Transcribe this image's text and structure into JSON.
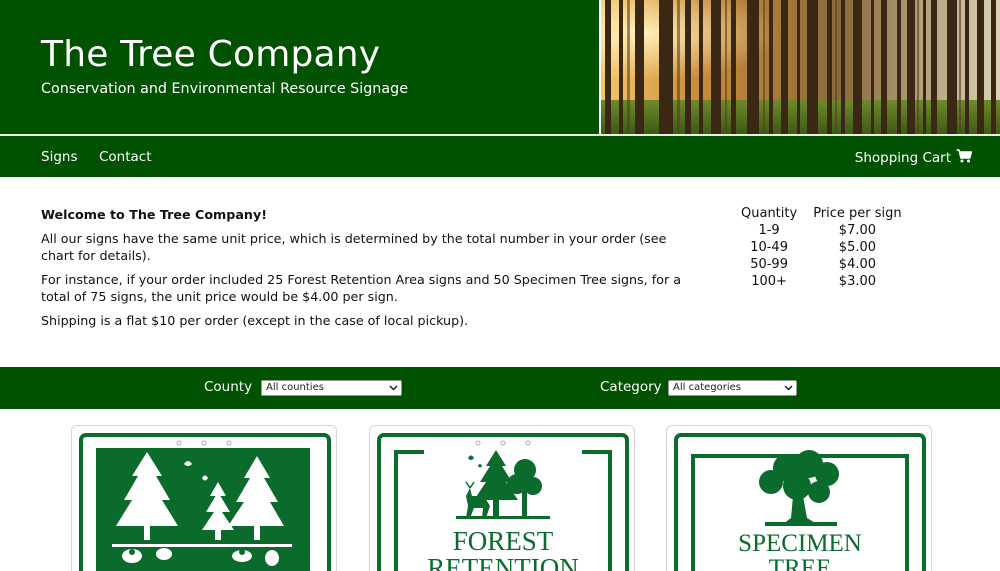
{
  "header": {
    "title": "The Tree Company",
    "subtitle": "Conservation and Environmental Resource Signage"
  },
  "nav": {
    "signs": "Signs",
    "contact": "Contact",
    "cart": "Shopping Cart",
    "cart_icon": "cart-icon"
  },
  "intro": {
    "welcome": "Welcome to The Tree Company!",
    "p1": "All our signs have the same unit price, which is determined by the total number in your order (see chart for details).",
    "p2": "For instance, if your order included 25 Forest Retention Area signs and 50 Specimen Tree signs, for a total of 75 signs, the unit price would be $4.00 per sign.",
    "p3": "Shipping is a flat $10 per order (except in the case of local pickup)."
  },
  "price_table": {
    "headers": [
      "Quantity",
      "Price per sign"
    ],
    "rows": [
      [
        "1-9",
        "$7.00"
      ],
      [
        "10-49",
        "$5.00"
      ],
      [
        "50-99",
        "$4.00"
      ],
      [
        "100+",
        "$3.00"
      ]
    ]
  },
  "filters": {
    "county_label": "County",
    "county_value": "All counties",
    "category_label": "Category",
    "category_value": "All categories"
  },
  "products": [
    {
      "name": "wildlife sign",
      "text": ""
    },
    {
      "name": "forest retention sign",
      "text_line1": "FOREST",
      "text_line2": "RETENTION"
    },
    {
      "name": "specimen tree sign",
      "text_line1": "SPECIMEN",
      "text_line2": "TREE"
    }
  ],
  "colors": {
    "brand_green": "#005200",
    "sign_green": "#0b6b2c"
  }
}
